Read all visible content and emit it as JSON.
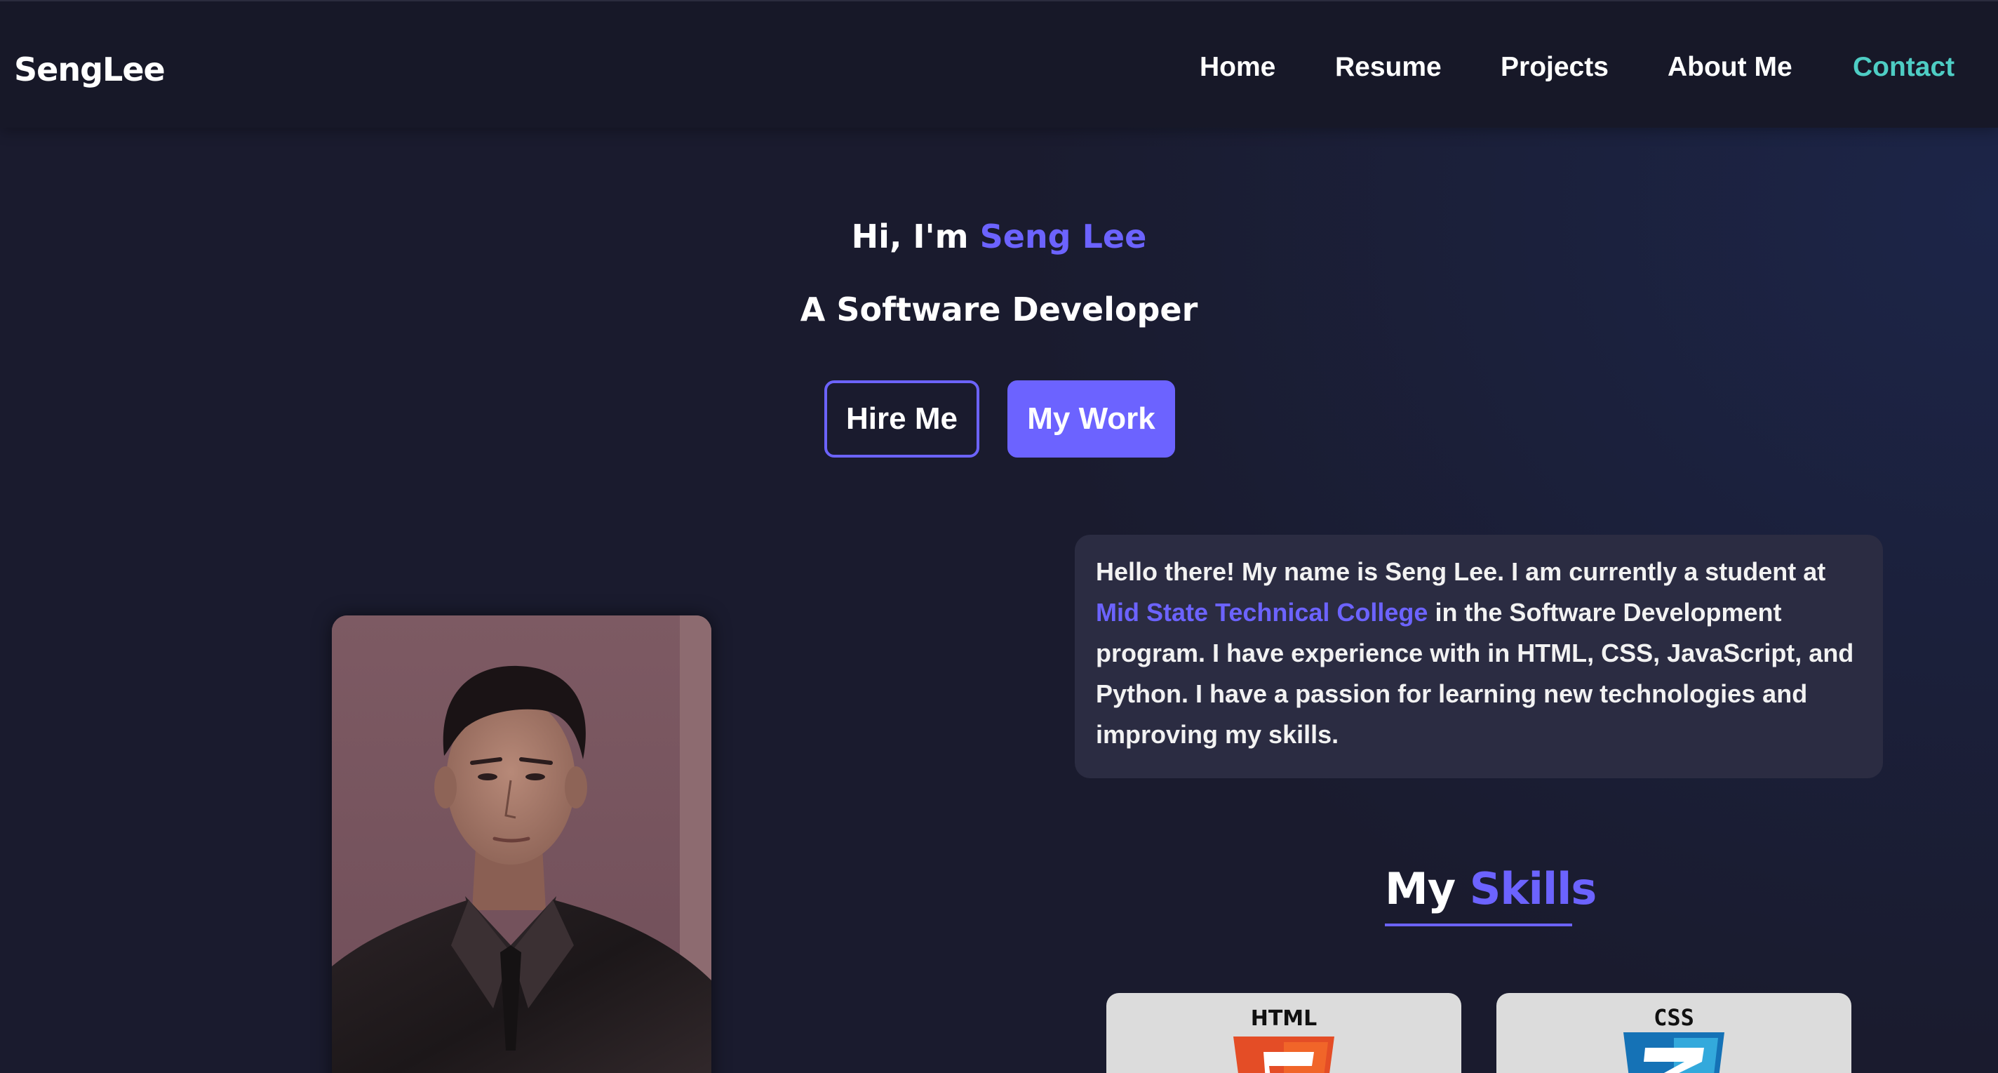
{
  "navbar": {
    "brand": "SengLee",
    "links": [
      "Home",
      "Resume",
      "Projects",
      "About Me",
      "Contact"
    ],
    "active_link": "Contact",
    "accent_active": "#4ecdc4"
  },
  "hero": {
    "greeting_prefix": "Hi, I'm ",
    "name": "Seng Lee",
    "role": "A Software Developer",
    "buttons": {
      "hire": "Hire Me",
      "work": "My Work"
    }
  },
  "portrait": {
    "alt": "Portrait of Seng Lee"
  },
  "about": {
    "text_before": "Hello there! My name is Seng Lee. I am currently a student at ",
    "college": "Mid State Technical College",
    "text_after": " in the Software Development program. I have experience with in HTML, CSS, JavaScript, and Python. I have a passion for learning new technologies and improving my skills."
  },
  "skills": {
    "title_prefix": "My ",
    "title_accent": "Skills",
    "items": [
      {
        "label": "HTML",
        "icon": "html5-icon"
      },
      {
        "label": "CSS",
        "icon": "css3-icon"
      }
    ]
  },
  "colors": {
    "background": "#1a1b2e",
    "navbar": "#171828",
    "accent": "#6c63ff",
    "contact": "#4ecdc4",
    "card": "#2b2c42"
  }
}
